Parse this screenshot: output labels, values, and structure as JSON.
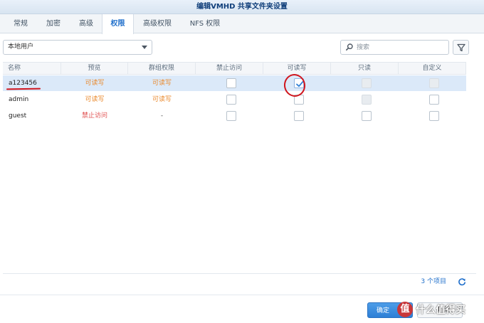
{
  "window": {
    "title": "编辑VMHD 共享文件夹设置"
  },
  "tabs": [
    {
      "label": "常规"
    },
    {
      "label": "加密"
    },
    {
      "label": "高级"
    },
    {
      "label": "权限"
    },
    {
      "label": "高级权限"
    },
    {
      "label": "NFS 权限"
    }
  ],
  "active_tab": "权限",
  "toolbar": {
    "user_type": {
      "selected": "本地用户"
    },
    "search": {
      "placeholder": "搜索",
      "value": ""
    },
    "filter_icon": "filter-icon",
    "search_icon": "search-icon"
  },
  "table": {
    "columns": [
      "名称",
      "预览",
      "群组权限",
      "禁止访问",
      "可读写",
      "只读",
      "自定义"
    ],
    "rows": [
      {
        "name": "a123456",
        "preview": "可读写",
        "group": "可读写",
        "deny": false,
        "rw": true,
        "ro": false,
        "custom": false,
        "ro_disabled": true,
        "custom_disabled": true,
        "selected": true
      },
      {
        "name": "admin",
        "preview": "可读写",
        "group": "可读写",
        "deny": false,
        "rw": false,
        "ro": false,
        "custom": false,
        "ro_disabled": true,
        "custom_disabled": false,
        "selected": false
      },
      {
        "name": "guest",
        "preview": "禁止访问",
        "group": "-",
        "deny": false,
        "rw": false,
        "ro": false,
        "custom": false,
        "ro_disabled": false,
        "custom_disabled": false,
        "selected": false
      }
    ]
  },
  "status": {
    "count": "3 个项目",
    "refresh_icon": "refresh-icon"
  },
  "footer": {
    "ok_label": "确定",
    "cancel_label": "取消"
  },
  "watermark": {
    "logo_char": "值",
    "text": "什么值得买"
  },
  "colors": {
    "accent": "#1f6fcb",
    "rw_text": "#ea8a2e",
    "deny_text": "#e05050",
    "annotation": "#d0161e",
    "selected_row": "#dbe9f9"
  }
}
